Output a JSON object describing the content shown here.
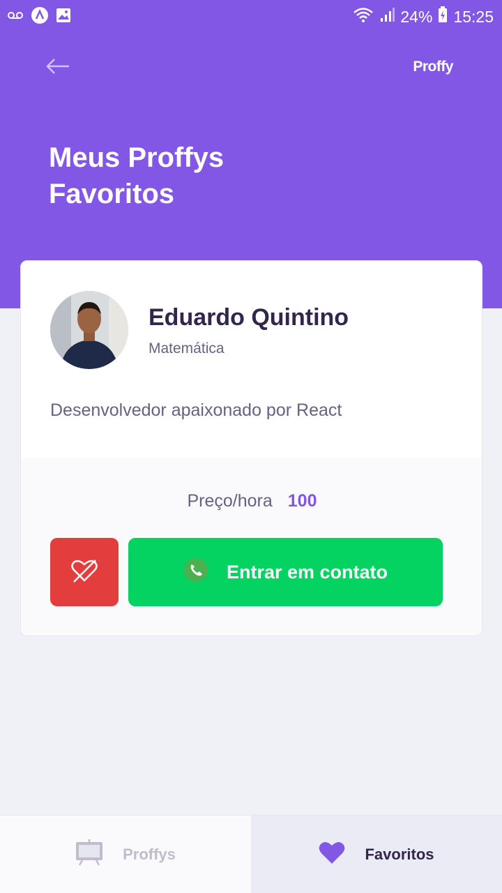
{
  "status_bar": {
    "battery": "24%",
    "time": "15:25",
    "icons": [
      "voicemail-icon",
      "app-icon",
      "image-icon",
      "wifi-icon",
      "signal-icon",
      "battery-icon"
    ]
  },
  "header": {
    "back_icon": "arrow-left-icon",
    "brand": "Proffy",
    "title": "Meus Proffys Favoritos"
  },
  "card": {
    "name": "Eduardo Quintino",
    "subject": "Matemática",
    "bio": "Desenvolvedor apaixonado por React",
    "price_label": "Preço/hora",
    "price_value": "100",
    "unfavorite_icon": "heart-outline-icon",
    "contact_label": "Entrar em contato",
    "contact_icon": "whatsapp-icon"
  },
  "tabs": [
    {
      "label": "Proffys",
      "icon": "easel-icon",
      "active": false
    },
    {
      "label": "Favoritos",
      "icon": "heart-icon",
      "active": true
    }
  ],
  "colors": {
    "primary": "#8257E5",
    "background": "#F0F0F7",
    "danger": "#E33D3D",
    "success": "#04D361",
    "title": "#32264D",
    "text": "#6A6180"
  }
}
